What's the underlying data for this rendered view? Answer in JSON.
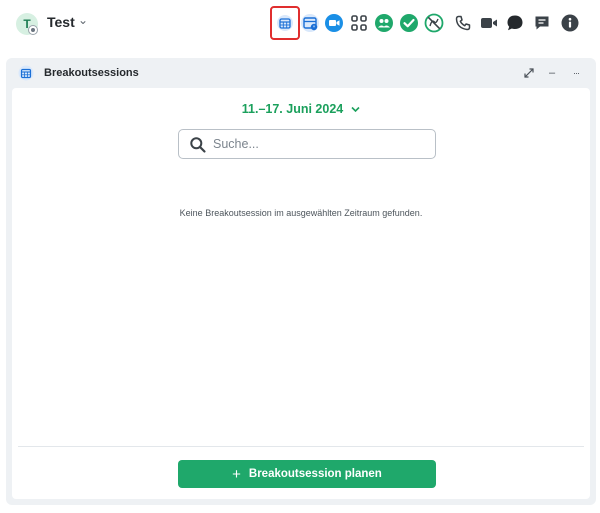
{
  "chat": {
    "avatar_initial": "T",
    "title": "Test",
    "title_chevron": "⌄"
  },
  "toolbar": {
    "icons": [
      "breakout-calendar-icon",
      "schedule-calendar-icon",
      "video-call-icon",
      "apps-grid-icon",
      "participants-icon",
      "check-icon",
      "no-sign-icon",
      "phone-icon",
      "video-camera-icon",
      "chat-bubble-icon",
      "notes-icon",
      "info-icon"
    ],
    "selected": "breakout-calendar-icon",
    "colors": {
      "blue": "#1a6fd6",
      "green": "#1fa86b",
      "dark": "#3b4248",
      "selected_frame": "#e02e2e"
    }
  },
  "panel": {
    "title": "Breakoutsessions",
    "controls": {
      "unpin": "⤡",
      "minimize": "–",
      "more": "···"
    },
    "date_range": "11.–17. Juni 2024",
    "date_chevron": "⌄",
    "search": {
      "placeholder": "Suche...",
      "value": ""
    },
    "empty_message": "Keine Breakoutsession im ausgewählten Zeitraum gefunden.",
    "primary_button": {
      "icon": "+",
      "label": "Breakoutsession planen"
    }
  }
}
